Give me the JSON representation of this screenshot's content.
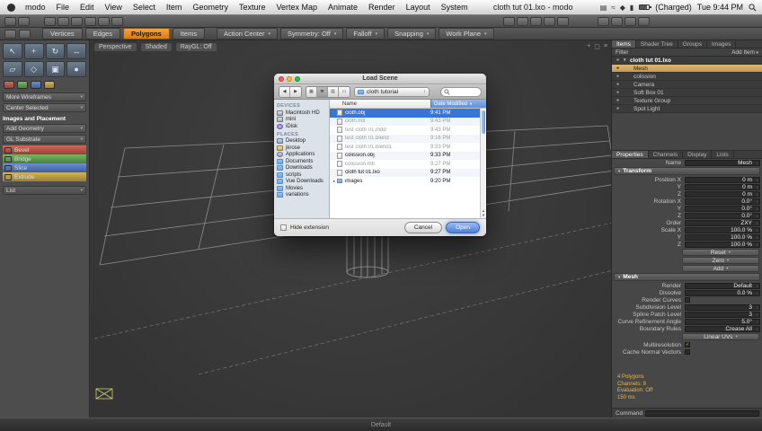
{
  "menubar": {
    "menus": [
      "modo",
      "File",
      "Edit",
      "View",
      "Select",
      "Item",
      "Geometry",
      "Texture",
      "Vertex Map",
      "Animate",
      "Render",
      "Layout",
      "System"
    ],
    "window_title": "cloth tut 01.lxo - modo",
    "extras": [
      {
        "name": "displays-icon",
        "glyph": "▤"
      },
      {
        "name": "airport-icon",
        "glyph": "≈"
      },
      {
        "name": "bluetooth-icon",
        "glyph": "◆"
      },
      {
        "name": "volume-icon",
        "glyph": "▮"
      }
    ],
    "battery_label": "(Charged)",
    "clock": "Tue 9:44 PM"
  },
  "toolbar": {
    "selection_modes": [
      {
        "label": "Vertices",
        "state": ""
      },
      {
        "label": "Edges",
        "state": ""
      },
      {
        "label": "Polygons",
        "state": "active"
      },
      {
        "label": "Items",
        "state": ""
      }
    ],
    "dropdowns": [
      {
        "label": "Action Center"
      },
      {
        "label": "Symmetry: Off"
      },
      {
        "label": "Falloff"
      },
      {
        "label": "Snapping"
      },
      {
        "label": "Work Plane"
      }
    ]
  },
  "left_panel": {
    "tool_icons": [
      {
        "name": "select-tool-icon",
        "glyph": "↖"
      },
      {
        "name": "move-tool-icon",
        "glyph": "+"
      },
      {
        "name": "rotate-tool-icon",
        "glyph": "↻"
      },
      {
        "name": "scale-tool-icon",
        "glyph": "↔"
      },
      {
        "name": "transform-tool-icon",
        "glyph": "▱"
      },
      {
        "name": "element-move-tool-icon",
        "glyph": "◇"
      },
      {
        "name": "falloff-tool-icon",
        "glyph": "▣"
      },
      {
        "name": "action-center-tool-icon",
        "glyph": "●"
      }
    ],
    "mini_icons": [
      {
        "name": "vertex-tools-icon",
        "state": "c-red"
      },
      {
        "name": "edge-tools-icon",
        "state": "c-green"
      },
      {
        "name": "polygon-tools-icon",
        "state": "c-blue"
      },
      {
        "name": "item-tools-icon",
        "state": "c-gold"
      }
    ],
    "dropdown_rows": [
      {
        "label": "More Wireframes"
      },
      {
        "label": "Center Selected"
      }
    ],
    "section_header": "Images and Placement",
    "rows2": [
      {
        "label": "Add Geometry"
      },
      {
        "label": "GL Substrate"
      }
    ],
    "tool_buttons": [
      {
        "label": "Bevel",
        "state": "c-red"
      },
      {
        "label": "Bridge",
        "state": "c-green"
      },
      {
        "label": "Slice",
        "state": "c-blue"
      },
      {
        "label": "Extrude",
        "state": "c-gold"
      }
    ],
    "footer_label": "List"
  },
  "viewport": {
    "camera_label": "Perspective",
    "shading_label": "Shaded",
    "raygl_label": "RayGL: Off"
  },
  "dialog": {
    "title": "Load Scene",
    "location_value": "cloth tutorial",
    "sidebar": {
      "devices_header": "DEVICES",
      "devices": [
        {
          "label": "Macintosh HD",
          "state": "hd"
        },
        {
          "label": "mini",
          "state": "hd"
        },
        {
          "label": "iDisk",
          "state": "idisk"
        }
      ],
      "places_header": "PLACES",
      "places": [
        {
          "label": "Desktop",
          "state": "desktop"
        },
        {
          "label": "jkrose",
          "state": "home"
        },
        {
          "label": "Applications",
          "state": "app"
        },
        {
          "label": "Documents",
          "state": ""
        },
        {
          "label": "Downloads",
          "state": ""
        },
        {
          "label": "scripts",
          "state": ""
        },
        {
          "label": "Vue Downloads",
          "state": ""
        },
        {
          "label": "Movies",
          "state": ""
        },
        {
          "label": "variations",
          "state": ""
        }
      ]
    },
    "columns": {
      "name": "Name",
      "date": "Date Modified"
    },
    "files": [
      {
        "name": "cloth.obj",
        "date": "9:41 PM",
        "state": "selected"
      },
      {
        "name": "cloth.mtl",
        "date": "9:43 PM",
        "state": "dim"
      },
      {
        "name": "test cloth 01.mdd",
        "date": "9:43 PM",
        "state": "dim"
      },
      {
        "name": "test cloth 01.blend",
        "date": "9:16 PM",
        "state": "dim"
      },
      {
        "name": "test cloth 01.blend1",
        "date": "9:33 PM",
        "state": "dim"
      },
      {
        "name": "colission.obj",
        "date": "9:33 PM",
        "state": ""
      },
      {
        "name": "colission.mtl",
        "date": "9:27 PM",
        "state": "dim"
      },
      {
        "name": "cloth tut 01.lxo",
        "date": "9:27 PM",
        "state": ""
      },
      {
        "name": "images",
        "date": "9:20 PM",
        "state": "folder"
      }
    ],
    "hide_extension_label": "Hide extension",
    "cancel_label": "Cancel",
    "open_label": "Open"
  },
  "right_panel": {
    "tabs": [
      {
        "label": "Items",
        "state": "active"
      },
      {
        "label": "Shader Tree",
        "state": ""
      },
      {
        "label": "Groups",
        "state": ""
      },
      {
        "label": "Images",
        "state": ""
      }
    ],
    "filter_label": "Filter",
    "add_item_label": "Add Item",
    "items": [
      {
        "label": "cloth tut 01.lxo",
        "state": "root"
      },
      {
        "label": "Mesh",
        "state": "selected"
      },
      {
        "label": "colission",
        "state": ""
      },
      {
        "label": "Camera",
        "state": ""
      },
      {
        "label": "Soft Box 01",
        "state": ""
      },
      {
        "label": "Texture Group",
        "state": ""
      },
      {
        "label": "Spot Light",
        "state": ""
      }
    ],
    "prop_tabs": [
      {
        "label": "Properties",
        "state": "active"
      },
      {
        "label": "Channels",
        "state": ""
      },
      {
        "label": "Display",
        "state": ""
      },
      {
        "label": "Lists",
        "state": ""
      }
    ],
    "name_label": "Name",
    "name_value": "Mesh",
    "transform_header": "Transform",
    "transform_rows": [
      {
        "label": "Position X",
        "value": "0 m"
      },
      {
        "label": "Y",
        "value": "0 m"
      },
      {
        "label": "Z",
        "value": "0 m"
      },
      {
        "label": "Rotation X",
        "value": "0.0°"
      },
      {
        "label": "Y",
        "value": "0.0°"
      },
      {
        "label": "Z",
        "value": "0.0°"
      },
      {
        "label": "Order",
        "value": "ZXY"
      },
      {
        "label": "Scale X",
        "value": "100.0 %"
      },
      {
        "label": "Y",
        "value": "100.0 %"
      },
      {
        "label": "Z",
        "value": "100.0 %"
      }
    ],
    "transform_buttons": [
      {
        "label": "Reset"
      },
      {
        "label": "Zero"
      },
      {
        "label": "Add"
      }
    ],
    "mesh_header": "Mesh",
    "mesh_fields1": [
      {
        "label": "Render",
        "value": "Default"
      },
      {
        "label": "Dissolve",
        "value": "0.0 %"
      }
    ],
    "mesh_checks1": [
      {
        "label": "Render Curves",
        "state": ""
      }
    ],
    "mesh_fields2": [
      {
        "label": "Subdivision Level",
        "value": "3"
      },
      {
        "label": "Spline Patch Level",
        "value": "3"
      },
      {
        "label": "Curve Refinement Angle",
        "value": "5.0°"
      },
      {
        "label": "Boundary Rules",
        "value": "Crease All"
      }
    ],
    "linear_uvs_label": "Linear UVs",
    "mesh_checks2": [
      {
        "label": "Multiresolution",
        "state": "checked"
      },
      {
        "label": "Cache Normal Vectors",
        "state": ""
      }
    ],
    "stats": [
      "4 Polygons",
      "Channels: 8",
      "Evaluation: Off",
      "150 ms"
    ],
    "command_label": "Command"
  },
  "statusbar": {
    "text": "Default"
  }
}
